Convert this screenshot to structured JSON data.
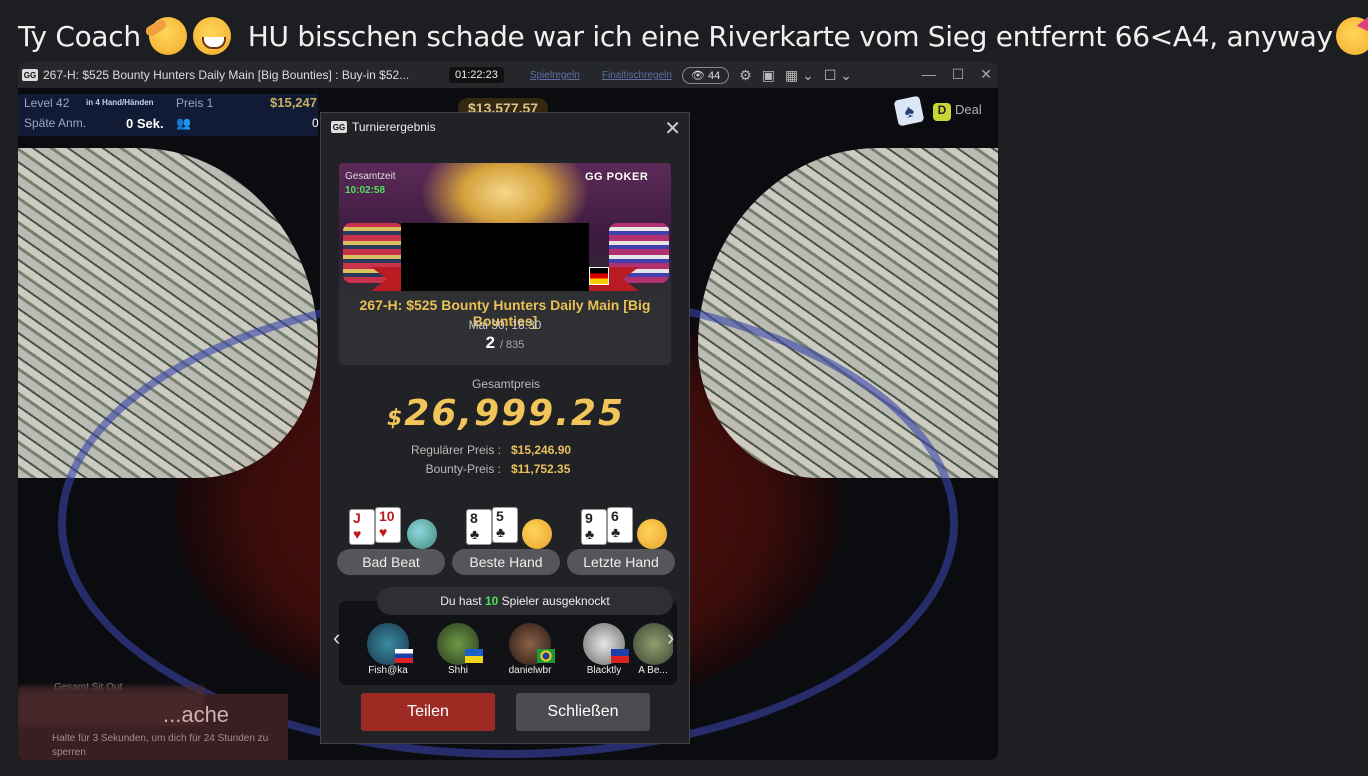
{
  "message": {
    "text_1": "Ty Coach",
    "emoji_1": "saluting-face",
    "emoji_2": "grinning-face",
    "text_2": "HU bisschen schade war ich eine Riverkarte vom Sieg entfernt 66<A4, anyway",
    "emoji_3": "partying-face"
  },
  "titlebar": {
    "logo": "GG",
    "title": "267-H: $525 Bounty Hunters Daily Main [Big Bounties] : Buy-in $52...",
    "clock": "01:22:23",
    "link_rules": "Spielregeln",
    "link_final": "Finaltischregeln",
    "watchers": "44"
  },
  "hud": {
    "level": "Level 42",
    "hand_info": "in 4 Hand/Händen",
    "preis_label": "Preis 1",
    "preis_value": "$15,247",
    "late_reg": "Späte Anm.",
    "late_reg_value": "0 Sek.",
    "players_left": "0"
  },
  "pot": "$13,577.57",
  "deal_label": "Deal",
  "bottom_panel": {
    "sitout": "Gesamt Sit Out",
    "title": "...ache",
    "hint": "Halte für 3 Sekunden, um dich für 24 Stunden zu sperren"
  },
  "dialog": {
    "title": "Turnierergebnis",
    "gesamtzeit_label": "Gesamtzeit",
    "gesamtzeit_value": "10:02:58",
    "brand": "GG POKER",
    "tournament_name": "267-H: $525 Bounty Hunters Daily Main [Big Bounties]",
    "date": "Mai 30, 18:30",
    "place": "2",
    "place_total": "/ 835",
    "gesamtpreis_label": "Gesamtpreis",
    "gesamtpreis_currency": "$",
    "gesamtpreis_value": "26,999.25",
    "regular_label": "Regulärer Preis :",
    "regular_value": "$15,246.90",
    "bounty_label": "Bounty-Preis :",
    "bounty_value": "$11,752.35",
    "hands": [
      {
        "label": "Bad Beat",
        "card1": "J",
        "card1_suit": "♥",
        "card2": "10",
        "card2_suit": "♥"
      },
      {
        "label": "Beste Hand",
        "card1": "8",
        "card1_suit": "♣",
        "card2": "5",
        "card2_suit": "♣"
      },
      {
        "label": "Letzte Hand",
        "card1": "9",
        "card1_suit": "♣",
        "card2": "6",
        "card2_suit": "♣"
      }
    ],
    "ko_prefix": "Du hast",
    "ko_count": "10",
    "ko_suffix": "Spieler ausgeknockt",
    "players": [
      {
        "name": "Fish@ka",
        "flag": "Russia"
      },
      {
        "name": "Shhi",
        "flag": "Ukraine"
      },
      {
        "name": "danielwbr",
        "flag": "Brazil"
      },
      {
        "name": "Blacktly",
        "flag": "Philippines"
      },
      {
        "name": "A Be..."
      }
    ],
    "share_button": "Teilen",
    "close_button": "Schließen"
  }
}
